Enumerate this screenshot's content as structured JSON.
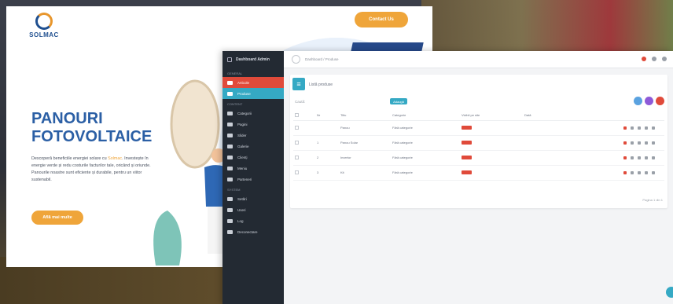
{
  "landing": {
    "logo_text": "SOLMAC",
    "cta_top": "Contact Us",
    "hero_title_line1": "PANOURI",
    "hero_title_line2": "FOTOVOLTAICE",
    "hero_text_before": "Descoperă beneficiile energiei solare cu ",
    "hero_text_highlight": "Solmac",
    "hero_text_after": ". Investește în energie verde și redu costurile facturilor tale, oricând și oriunde. Panourile noastre sunt eficiente și durabile, pentru un viitor sustenabil.",
    "hero_button": "Află mai multe"
  },
  "admin": {
    "brand": "Dashboard Admin",
    "sections": {
      "main": "General",
      "content": "Content",
      "system": "System"
    },
    "nav_main": [
      {
        "label": "Articole",
        "state": "red"
      },
      {
        "label": "Produse",
        "state": "teal"
      }
    ],
    "nav_content": [
      {
        "label": "Categorii"
      },
      {
        "label": "Pagini"
      },
      {
        "label": "Slider"
      },
      {
        "label": "Galerie"
      },
      {
        "label": "Clienți"
      },
      {
        "label": "Meniu"
      },
      {
        "label": "Parteneri"
      }
    ],
    "nav_system": [
      {
        "label": "Setări"
      },
      {
        "label": "Useri"
      },
      {
        "label": "Log"
      },
      {
        "label": "Deconectare"
      }
    ],
    "breadcrumb": "Dashboard / Produse",
    "panel_title": "Listă produse",
    "search_label": "Caută:",
    "add_button": "Adaugă",
    "columns": [
      "",
      "Nr",
      "Titlu",
      "Categorie",
      "Vizibil pe site",
      "Dată",
      ""
    ],
    "rows": [
      {
        "nr": "",
        "title": "Panou",
        "category": "Fără categorie"
      },
      {
        "nr": "1",
        "title": "Panou Solar",
        "category": "Fără categorie"
      },
      {
        "nr": "2",
        "title": "Invertor",
        "category": "Fără categorie"
      },
      {
        "nr": "3",
        "title": "Kit",
        "category": "Fără categorie"
      }
    ],
    "pagination": "Pagina 1 din 1",
    "colors": {
      "sidebar": "#232a33",
      "accent_teal": "#35a9c4",
      "accent_red": "#e04a3a",
      "accent_orange": "#efa53a",
      "brand_blue": "#2b5fa5"
    }
  }
}
